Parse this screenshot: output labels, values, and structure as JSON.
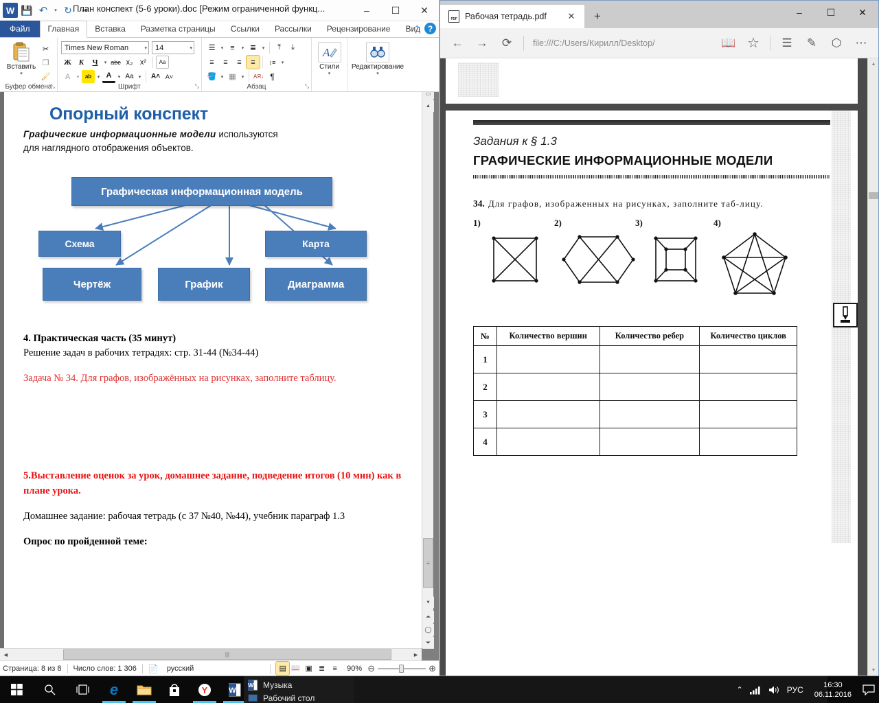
{
  "word": {
    "title": "План конспект (5-6 уроки).doc [Режим ограниченной функц...",
    "logo": "W",
    "quick_access": [
      {
        "name": "save-icon",
        "glyph": "💾"
      },
      {
        "name": "undo-icon",
        "glyph": "↶"
      },
      {
        "name": "undo-dropdown-icon",
        "glyph": "▾"
      },
      {
        "name": "redo-icon",
        "glyph": "↻"
      },
      {
        "name": "customize-qat-icon",
        "glyph": "≡▾"
      }
    ],
    "window_buttons": {
      "minimize": "–",
      "maximize": "☐",
      "close": "✕"
    },
    "tabs": [
      {
        "label": "Файл",
        "kind": "file"
      },
      {
        "label": "Главная",
        "kind": "active"
      },
      {
        "label": "Вставка",
        "kind": "normal"
      },
      {
        "label": "Разметка страницы",
        "kind": "normal"
      },
      {
        "label": "Ссылки",
        "kind": "normal"
      },
      {
        "label": "Рассылки",
        "kind": "normal"
      },
      {
        "label": "Рецензирование",
        "kind": "normal"
      },
      {
        "label": "Вид",
        "kind": "normal"
      }
    ],
    "tabs_right": {
      "minimize_ribbon": "⌃",
      "help": "?"
    },
    "ribbon": {
      "groups": [
        {
          "label": "Буфер обмена",
          "dialog_launcher": "⤡",
          "big_button": {
            "label": "Вставить",
            "icon": "clipboard-icon",
            "caret": "▾"
          },
          "small_buttons": [
            {
              "name": "cut-icon",
              "glyph": "✂"
            },
            {
              "name": "copy-icon",
              "glyph": "❐"
            },
            {
              "name": "format-painter-icon",
              "glyph": "🖌"
            }
          ]
        },
        {
          "label": "Шрифт",
          "dialog_launcher": "⤡",
          "font_name": "Times New Roman",
          "font_size": "14",
          "row1": [
            {
              "name": "bold-button",
              "glyph": "Ж"
            },
            {
              "name": "italic-button",
              "glyph": "К"
            },
            {
              "name": "underline-button",
              "glyph": "Ч"
            },
            {
              "name": "underline-dropdown-icon",
              "glyph": "▾"
            },
            {
              "name": "strikethrough-button",
              "glyph": "abc"
            },
            {
              "name": "subscript-button",
              "glyph": "x₂"
            },
            {
              "name": "superscript-button",
              "glyph": "x²"
            },
            {
              "name": "change-case-button",
              "glyph": "Aa"
            }
          ],
          "row2": [
            {
              "name": "text-effects-button",
              "glyph": "A"
            },
            {
              "name": "text-effects-dropdown-icon",
              "glyph": "▾"
            },
            {
              "name": "highlight-color-button",
              "glyph": "ab"
            },
            {
              "name": "highlight-dropdown-icon",
              "glyph": "▾"
            },
            {
              "name": "font-color-button",
              "glyph": "A"
            },
            {
              "name": "font-color-dropdown-icon",
              "glyph": "▾"
            },
            {
              "name": "change-case-button2",
              "glyph": "Aa"
            },
            {
              "name": "case-dropdown-icon",
              "glyph": "▾"
            },
            {
              "name": "grow-font-button",
              "glyph": "A˄"
            },
            {
              "name": "shrink-font-button",
              "glyph": "A˅"
            }
          ]
        },
        {
          "label": "Абзац",
          "dialog_launcher": "⤡",
          "row1": [
            {
              "name": "bullets-button",
              "glyph": "☰"
            },
            {
              "name": "bullets-dropdown-icon",
              "glyph": "▾"
            },
            {
              "name": "numbering-button",
              "glyph": "≡"
            },
            {
              "name": "numbering-dropdown-icon",
              "glyph": "▾"
            },
            {
              "name": "multilevel-list-button",
              "glyph": "≣"
            },
            {
              "name": "multilevel-dropdown-icon",
              "glyph": "▾"
            },
            {
              "name": "decrease-indent-button",
              "glyph": "⤒"
            },
            {
              "name": "increase-indent-button",
              "glyph": "⤓"
            }
          ],
          "row2": [
            {
              "name": "align-left-button",
              "glyph": "≡"
            },
            {
              "name": "align-center-button",
              "glyph": "≡"
            },
            {
              "name": "align-right-button",
              "glyph": "≡"
            },
            {
              "name": "align-justify-button",
              "glyph": "≡",
              "selected": true
            },
            {
              "name": "line-spacing-button",
              "glyph": "↕≡"
            },
            {
              "name": "line-spacing-dropdown-icon",
              "glyph": "▾"
            }
          ],
          "row3": [
            {
              "name": "shading-button",
              "glyph": "🪣"
            },
            {
              "name": "shading-dropdown-icon",
              "glyph": "▾"
            },
            {
              "name": "borders-button",
              "glyph": "▦"
            },
            {
              "name": "borders-dropdown-icon",
              "glyph": "▾"
            },
            {
              "name": "sort-button",
              "glyph": "АЯ↓"
            },
            {
              "name": "show-formatting-button",
              "glyph": "¶"
            }
          ]
        },
        {
          "label": "",
          "big_button": {
            "label": "Стили",
            "icon": "styles-icon",
            "caret": "▾"
          }
        },
        {
          "label": "",
          "big_button": {
            "label": "Редактирование",
            "icon": "find-binoculars-icon",
            "caret": "▾"
          }
        }
      ]
    },
    "document": {
      "heading": "Опорный конспект",
      "intro_italic": "Графические  информационные  модели",
      "intro_rest": " используются",
      "intro_line2": "для наглядного отображения объектов.",
      "diagram": {
        "root": "Графическая информационная модель",
        "children": [
          "Схема",
          "Карта",
          "Чертёж",
          "График",
          "Диаграмма"
        ],
        "box_color": "#4a7ebb",
        "arrow_color": "#4a7ebb"
      },
      "blocks": [
        {
          "text": "4. Практическая часть (35 минут)",
          "style": "bold"
        },
        {
          "text": "Решение задач в рабочих тетрадях: стр. 31-44 (№34-44)",
          "style": "normal"
        },
        {
          "text": "",
          "style": "spacer"
        },
        {
          "text": "Задача № 34. Для графов, изображённых на рисунках, заполните таблицу.",
          "style": "red"
        },
        {
          "text": "",
          "style": "biggap"
        },
        {
          "text": "5.Выставление оценок за урок, домашнее задание, подведение итогов (10 мин) как в плане урока.",
          "style": "redbold"
        },
        {
          "text": "",
          "style": "spacer"
        },
        {
          "text": "Домашнее задание: рабочая тетрадь (с 37 №40, №44), учебник параграф 1.3",
          "style": "normal"
        },
        {
          "text": "",
          "style": "spacer"
        },
        {
          "text": "Опрос по пройденной теме:",
          "style": "bold"
        }
      ]
    },
    "status_bar": {
      "page": "Страница: 8 из 8",
      "words": "Число слов: 1 306",
      "proofing_icon": "spellcheck-icon",
      "language": "русский",
      "view_buttons": [
        {
          "name": "print-layout-view-button",
          "glyph": "▤",
          "selected": true
        },
        {
          "name": "fullscreen-reading-view-button",
          "glyph": "📖",
          "selected": false
        },
        {
          "name": "web-layout-view-button",
          "glyph": "▣",
          "selected": false
        },
        {
          "name": "outline-view-button",
          "glyph": "≣",
          "selected": false
        },
        {
          "name": "draft-view-button",
          "glyph": "≡",
          "selected": false
        }
      ],
      "zoom": "90%",
      "zoom_out": "⊖",
      "zoom_in": "⊕"
    }
  },
  "edge": {
    "tab": {
      "title": "Рабочая тетрадь.pdf",
      "file_icon": "pdf-file-icon",
      "close": "✕"
    },
    "new_tab": "+",
    "window_buttons": {
      "minimize": "–",
      "maximize": "☐",
      "close": "✕"
    },
    "toolbar": {
      "back": "←",
      "forward": "→",
      "refresh": "⟳",
      "address": "file:///C:/Users/Кирилл/Desktop/",
      "reading_view": "📖",
      "favorite": "☆",
      "hub": "☰",
      "notes": "✎",
      "share": "⬡",
      "more": "⋯"
    },
    "pdf": {
      "section_label": "Задания к § 1.3",
      "title": "ГРАФИЧЕСКИЕ ИНФОРМАЦИОННЫЕ МОДЕЛИ",
      "task_number": "34.",
      "task_text": "Для  графов,  изображенных  на  рисунках,  заполните  таб-лицу.",
      "figure_labels": [
        "1)",
        "2)",
        "3)",
        "4)"
      ],
      "graphs": [
        {
          "label": "1)",
          "vertices": 4,
          "description": "square-with-both-diagonals"
        },
        {
          "label": "2)",
          "vertices": 6,
          "description": "hexagon-with-crossing-chords"
        },
        {
          "label": "3)",
          "vertices": 8,
          "description": "nested-squares"
        },
        {
          "label": "4)",
          "vertices": 5,
          "description": "complete-pentagon-with-pentagram"
        }
      ],
      "table": {
        "headers": [
          "№",
          "Количество вершин",
          "Количество ребер",
          "Количество циклов"
        ],
        "rows": [
          {
            "num": "1",
            "cells": [
              "",
              "",
              ""
            ]
          },
          {
            "num": "2",
            "cells": [
              "",
              "",
              ""
            ]
          },
          {
            "num": "3",
            "cells": [
              "",
              "",
              ""
            ]
          },
          {
            "num": "4",
            "cells": [
              "",
              "",
              ""
            ]
          }
        ]
      },
      "margin_icon": "pencil-exercise-icon"
    }
  },
  "taskbar": {
    "start": "windows-logo-icon",
    "search": "search-icon",
    "task_view": "task-view-icon",
    "apps": [
      {
        "name": "edge-icon",
        "glyph": "e",
        "color": "#0e7ac4",
        "active": true
      },
      {
        "name": "file-explorer-icon",
        "glyph": "📁",
        "color": "#f0c674",
        "active": true
      },
      {
        "name": "store-icon",
        "glyph": "🛍",
        "color": "#ffffff",
        "active": false
      },
      {
        "name": "yandex-browser-icon",
        "glyph": "Y",
        "color": "#e8342a",
        "active": true
      },
      {
        "name": "word-icon",
        "glyph": "W",
        "color": "#2b579a",
        "active": true
      }
    ],
    "jumplist": [
      {
        "label": "Музыка",
        "icon": "word-icon"
      },
      {
        "label": "Рабочий стол",
        "icon": "folder-icon"
      }
    ],
    "tray": {
      "show_hidden": "⌃",
      "network": "network-signal-icon",
      "volume": "volume-icon",
      "language": "РУС",
      "time": "16:30",
      "date": "06.11.2016",
      "action_center": "notification-icon"
    }
  }
}
